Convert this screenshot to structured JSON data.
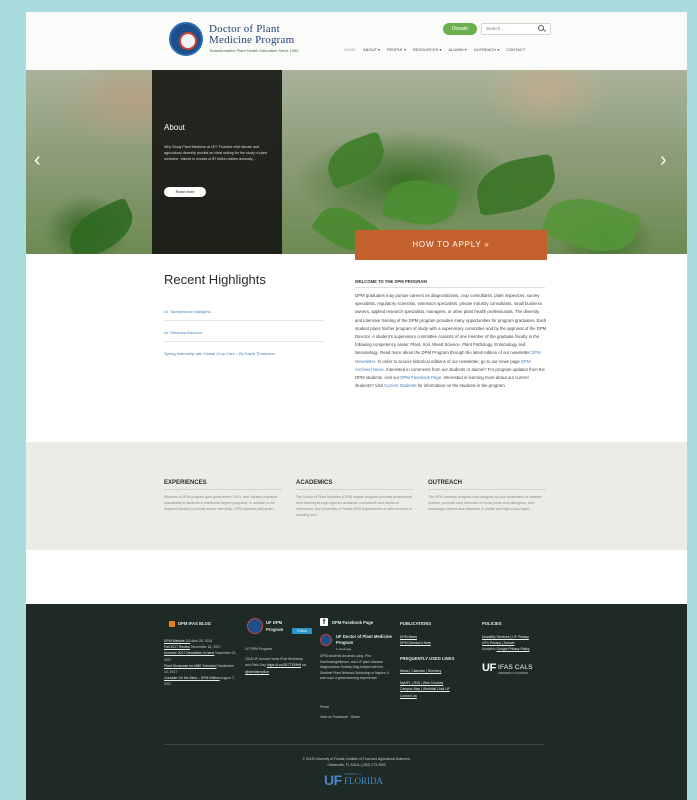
{
  "header": {
    "logo_title_line1": "Doctor of Plant",
    "logo_title_line2": "Medicine Program",
    "tagline": "Transformative Plant Health Education Since 1999",
    "donate_label": "Donate",
    "search_placeholder": "Search ...",
    "nav": [
      "HOME",
      "ABOUT ▾",
      "PEOPLE ▾",
      "RESOURCES ▾",
      "ALUMNI ▾",
      "OUTREACH ▾",
      "CONTACT"
    ]
  },
  "hero": {
    "about_title": "About",
    "about_text": "Why Study Plant Medicine at UF? Florida's mild climate and agricultural diversity provide an ideal setting for the study of plant medicine. Valued in excess of $7 billion dollars annually,...",
    "read_more_label": "Read more",
    "prev_arrow": "‹",
    "next_arrow": "›"
  },
  "apply": {
    "label": "HOW TO APPLY »"
  },
  "highlights": {
    "title": "Recent Highlights",
    "items": [
      "Dr. Tachamarum Mangkhu",
      "Dr. Rebecca Barocco",
      "Spring Internship with Global Crop Care – By Kayla Thompson"
    ]
  },
  "welcome": {
    "heading": "WELCOME TO THE DPM PROGRAM",
    "body_1": "DPM graduates may pursue careers as diagnosticians, crop consultants, plant inspectors, survey specialists, regulatory scientists, extension specialists, private industry consultants, small business owners, applied research specialists, managers, or other plant health professionals. The diversity and intensive training of the DPM program provides many opportunities for program graduates. Each student plans his/her program of study with a supervisory committee and by the approval of the DPM Director. A student's supervisory committee consists of one member of the graduate faculty in the following competency areas: Plant, Soil, Weed Science, Plant Pathology, Entomology and Nematology. Read more about the DPM Program through the latest edition of our newsletter ",
    "link_newsletter": "DPM Newsletter",
    "body_2": ". In order to access historical editions of our newsletter, go to our news page ",
    "link_archived": "DPM Archived News",
    "body_3": ". Interested in comments from our students or alumni? For program updates from the DPM students, visit our ",
    "link_facebook": "DPM Facebook Page",
    "body_4": ". Interested in learning more about our current students? Visit ",
    "link_students": "Current Students",
    "body_5": " for information on the students in the program."
  },
  "features": [
    {
      "title": "EXPERIENCES",
      "text": "Students in DPM program gain government, NGO, and industry exposure unavailable to students in traditional degree programs. In addition to the required industry or private sector internship, DPM students participate..."
    },
    {
      "title": "ACADEMICS",
      "text": "The Doctor of Plant Medicine (DPM) degree program provides professional level training through rigorous academic coursework and hands-on internships. Any University of Florida IFAS departments or units involved in teaching and..."
    },
    {
      "title": "OUTREACH",
      "text": "The DPM outreach program was designed by your awareness of invasive species, promote early detection of exotic pests and pathogens, and encourage careers and education in middle and high school aged..."
    }
  ],
  "footer": {
    "blog": {
      "heading": "DPM IFAS BLOG",
      "posts": [
        {
          "title": "DPM Website 2.0",
          "date": "April 28, 2018"
        },
        {
          "title": "Fall 2017 Review",
          "date": "December 18, 2017"
        },
        {
          "title": "Summer 2017 Newsletter is here!",
          "date": "November 21, 2017"
        },
        {
          "title": "Plant Showcase for MBE Scholars!",
          "date": "September 10, 2017"
        },
        {
          "title": "Consider On the Mind – DPM Edition",
          "date": "August 7, 2017"
        }
      ]
    },
    "twitter": {
      "name_line1": "UF DPM",
      "name_line2": "Program",
      "follow_label": "Follow",
      "handle": "UF DPM Program",
      "tweet": "2018 UF Annual Home Fruit Workshop and Field Day ",
      "tweet_link": "https://t.co/ZK7TE0fHif",
      "tweet_via": " via ",
      "tweet_link2": "@sheriberry4uh"
    },
    "facebook": {
      "heading": "DPM Facebook Page",
      "page_name": "UF Doctor of Plant Medicine Program",
      "page_time": "1 week ago",
      "post": "DPM students Amanda Lang, Pha Kanthasingthikham, and UF plant disease diagnostician Sudeep Bag helped with the Sentinel Plant Network Workshop in Naples. It was such a great learning experience!",
      "photos_label": "Photo",
      "view_label": "View on Facebook · Share"
    },
    "publications": {
      "heading": "PUBLICATIONS",
      "items": [
        "DPM News",
        "DPM Director's Note"
      ]
    },
    "frequent": {
      "heading": "FREQUENTLY USED LINKS",
      "items": [
        "News | Calendar | Directory",
        "MyUFL | ISIS | Web Courses",
        "Campus Map | WebMail | Ask UF",
        "Contact Us"
      ]
    },
    "policies": {
      "heading": "POLICIES",
      "items": [
        "Disability Services | UF Privacy",
        "UF's Privacy | Search"
      ],
      "analytics_prefix": "Analytics ",
      "analytics_link": "Google Privacy Policy"
    },
    "ifas_logo_uf": "UF",
    "ifas_logo_text": "IFAS CALS",
    "ifas_logo_sub": "UNIVERSITY of FLORIDA",
    "copyright_line1": "© 2018 University of Florida, Institute of Food and Agricultural Sciences.",
    "copyright_line2": "Gainesville, FL 32611 | (352) 273-3902",
    "uf_logo": "UF",
    "uf_logo_text": "FLORIDA",
    "uf_logo_small": "UNIVERSITY of"
  },
  "colors": {
    "accent_green": "#6ab04c",
    "apply_orange": "#c4602b",
    "footer_bg": "#1d2a26",
    "link_blue": "#3e7fb8",
    "page_background": "#a9dcdc"
  }
}
